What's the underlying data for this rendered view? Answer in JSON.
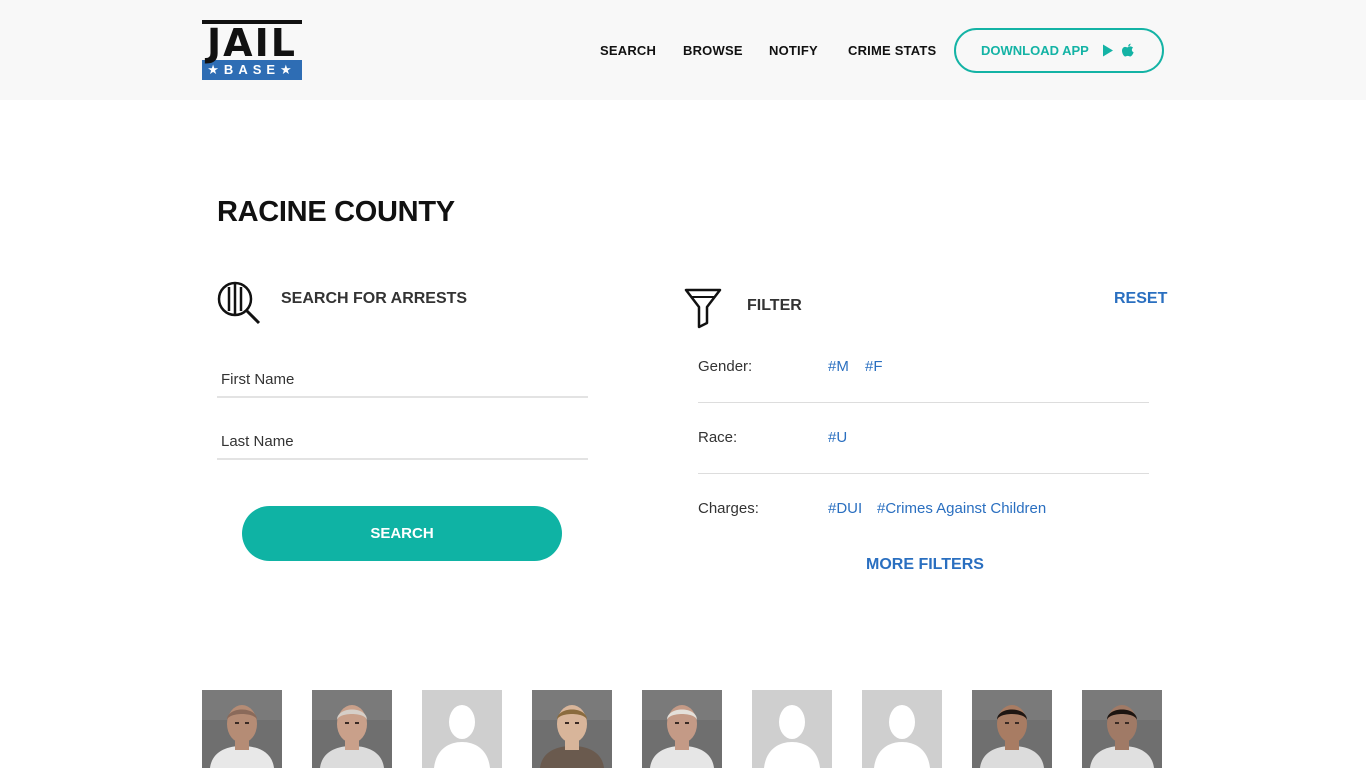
{
  "header": {
    "logo": {
      "top": "JAIL",
      "bottom": "★BASE★"
    },
    "nav": [
      {
        "label": "SEARCH"
      },
      {
        "label": "BROWSE"
      },
      {
        "label": "NOTIFY"
      },
      {
        "label": "CRIME STATS"
      }
    ],
    "download_app": {
      "label": "DOWNLOAD APP",
      "icons": [
        "play-store-icon",
        "apple-icon"
      ]
    },
    "accent_color": "#14b3a5"
  },
  "page": {
    "title": "RACINE COUNTY"
  },
  "search": {
    "heading": "SEARCH FOR ARRESTS",
    "first_name_placeholder": "First Name",
    "last_name_placeholder": "Last Name",
    "button_label": "SEARCH"
  },
  "filter": {
    "heading": "FILTER",
    "reset_label": "RESET",
    "rows": [
      {
        "label": "Gender:",
        "tags": [
          "#M",
          "#F"
        ]
      },
      {
        "label": "Race:",
        "tags": [
          "#U"
        ]
      },
      {
        "label": "Charges:",
        "tags": [
          "#DUI",
          "#Crimes Against Children"
        ]
      }
    ],
    "more_filters_label": "MORE FILTERS",
    "link_color": "#2a6fc0"
  },
  "mugshots": [
    {
      "type": "photo"
    },
    {
      "type": "photo"
    },
    {
      "type": "placeholder"
    },
    {
      "type": "photo"
    },
    {
      "type": "photo"
    },
    {
      "type": "placeholder"
    },
    {
      "type": "placeholder"
    },
    {
      "type": "photo"
    },
    {
      "type": "photo"
    }
  ]
}
